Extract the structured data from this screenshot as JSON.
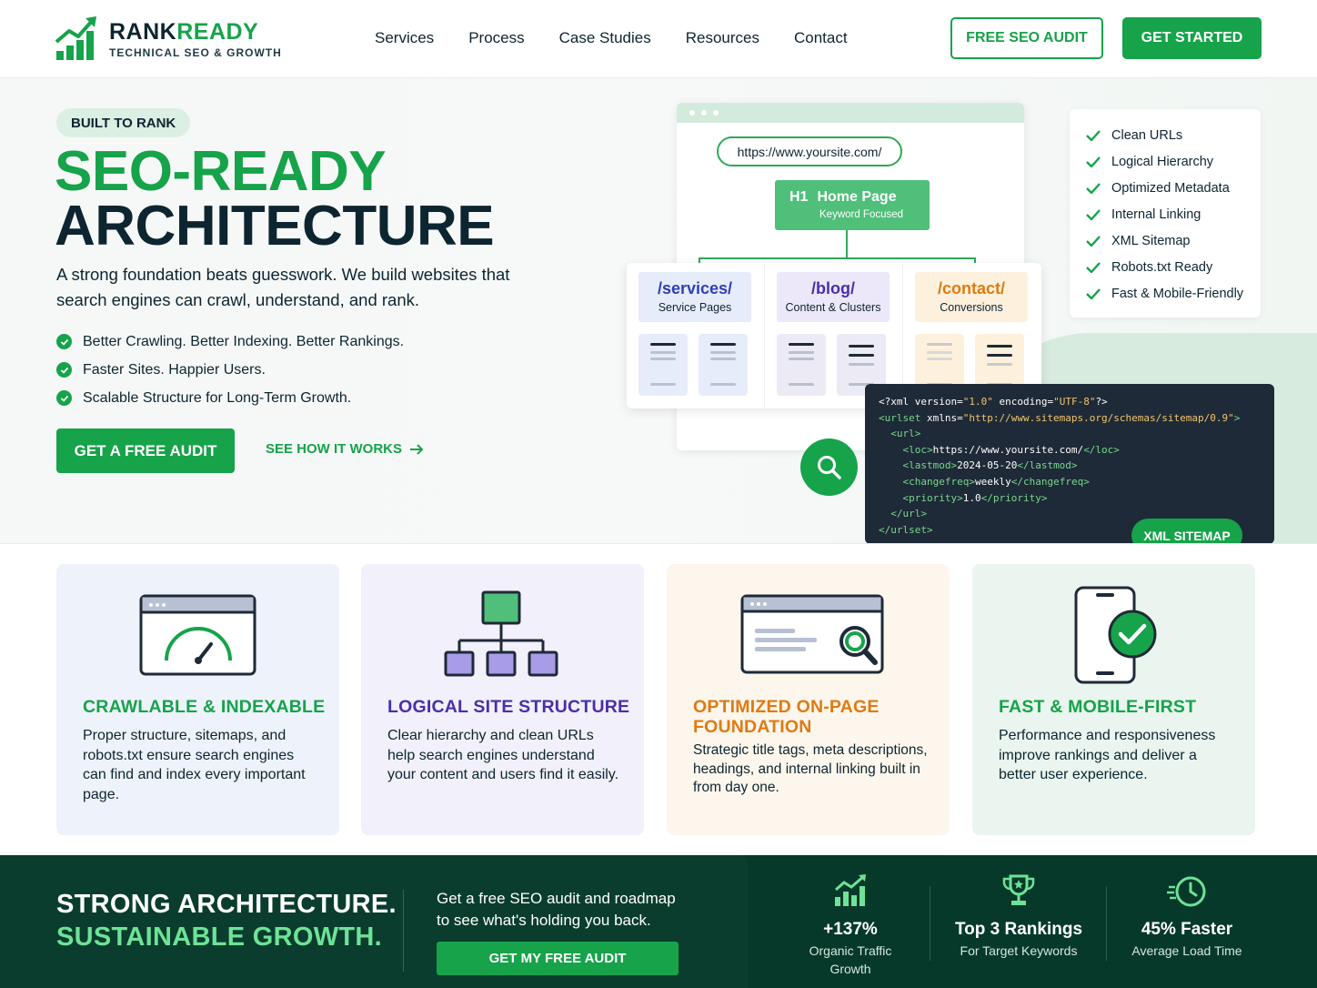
{
  "brand": {
    "name_part1": "RANK",
    "name_part2": "READY",
    "tagline": "TECHNICAL SEO & GROWTH",
    "accent_color": "#16a34a",
    "dark_color": "#0d2530"
  },
  "nav": {
    "items": [
      "Services",
      "Process",
      "Case Studies",
      "Resources",
      "Contact"
    ],
    "audit_button": "FREE SEO AUDIT",
    "start_button": "GET STARTED"
  },
  "hero": {
    "eyebrow": "BUILT TO RANK",
    "title_line1": "SEO-READY",
    "title_line2": "ARCHITECTURE",
    "lede": "A strong foundation beats guesswork. We build websites that search engines can crawl, understand, and rank.",
    "checks": [
      "Better Crawling. Better Indexing. Better Rankings.",
      "Faster Sites. Happier Users.",
      "Scalable Structure for Long-Term Growth."
    ],
    "cta_primary": "GET A FREE AUDIT",
    "cta_secondary": "SEE HOW IT WORKS"
  },
  "mockup": {
    "url": "https://www.yoursite.com/",
    "home": {
      "tag": "H1",
      "title": "Home Page",
      "subtitle": "Keyword Focused"
    },
    "sections": [
      {
        "path": "/services/",
        "desc": "Service Pages",
        "color": "#2f3fb5",
        "bg": "#e7ecfb"
      },
      {
        "path": "/blog/",
        "desc": "Content & Clusters",
        "color": "#4a2fa8",
        "bg": "#ece8fa"
      },
      {
        "path": "/contact/",
        "desc": "Conversions",
        "color": "#e07a12",
        "bg": "#fdf1dd"
      }
    ],
    "features": [
      "Clean URLs",
      "Logical Hierarchy",
      "Optimized Metadata",
      "Internal Linking",
      "XML Sitemap",
      "Robots.txt Ready",
      "Fast & Mobile-Friendly"
    ],
    "code": {
      "l1_a": "<?xml version=",
      "l1_b": "\"1.0\"",
      "l1_c": " encoding=",
      "l1_d": "\"UTF-8\"",
      "l1_e": "?>",
      "l2_a": "<urlset",
      "l2_b": " xmlns=",
      "l2_c": "\"http://www.sitemaps.org/schemas/sitemap/0.9\"",
      "l2_d": ">",
      "l3": "  <url>",
      "l4_a": "    <loc>",
      "l4_b": "https://www.yoursite.com/",
      "l4_c": "</loc>",
      "l5_a": "    <lastmod>",
      "l5_b": "2024-05-20",
      "l5_c": "</lastmod>",
      "l6_a": "    <changefreq>",
      "l6_b": "weekly",
      "l6_c": "</changefreq>",
      "l7_a": "    <priority>",
      "l7_b": "1.0",
      "l7_c": "</priority>",
      "l8": "  </url>",
      "l9": "</urlset>"
    },
    "code_badge": "XML SITEMAP"
  },
  "cards": [
    {
      "title": "CRAWLABLE & INDEXABLE",
      "desc": "Proper structure, sitemaps, and robots.txt ensure search engines can find and index every important page.",
      "color": "#16a34a",
      "bg": "#eef2fb",
      "icon": "speedometer-browser-icon"
    },
    {
      "title": "LOGICAL SITE STRUCTURE",
      "desc": "Clear hierarchy and clean URLs help search engines understand your content and users find it easily.",
      "color": "#4a2fa8",
      "bg": "#f1f0fb",
      "icon": "sitemap-tree-icon"
    },
    {
      "title_line1": "OPTIMIZED ON-PAGE",
      "title_line2": "FOUNDATION",
      "desc": "Strategic title tags, meta descriptions, headings, and internal linking built in from day one.",
      "color": "#e07a12",
      "bg": "#fdf6ec",
      "icon": "page-search-icon"
    },
    {
      "title": "FAST & MOBILE-FIRST",
      "desc": "Performance and responsiveness improve rankings and deliver a better user experience.",
      "color": "#16a34a",
      "bg": "#e9f5ee",
      "icon": "mobile-check-icon"
    }
  ],
  "band": {
    "headline1": "STRONG ARCHITECTURE.",
    "headline2": "SUSTAINABLE GROWTH.",
    "copy": "Get a free SEO audit and roadmap to see what's holding you back.",
    "button": "GET MY FREE AUDIT",
    "stats": [
      {
        "value": "+137%",
        "label1": "Organic Traffic",
        "label2": "Growth",
        "icon": "growth-chart-icon"
      },
      {
        "value": "Top 3 Rankings",
        "label1": "For Target Keywords",
        "label2": "",
        "icon": "trophy-icon"
      },
      {
        "value": "45% Faster",
        "label1": "Average Load Time",
        "label2": "",
        "icon": "stopwatch-icon"
      }
    ]
  }
}
